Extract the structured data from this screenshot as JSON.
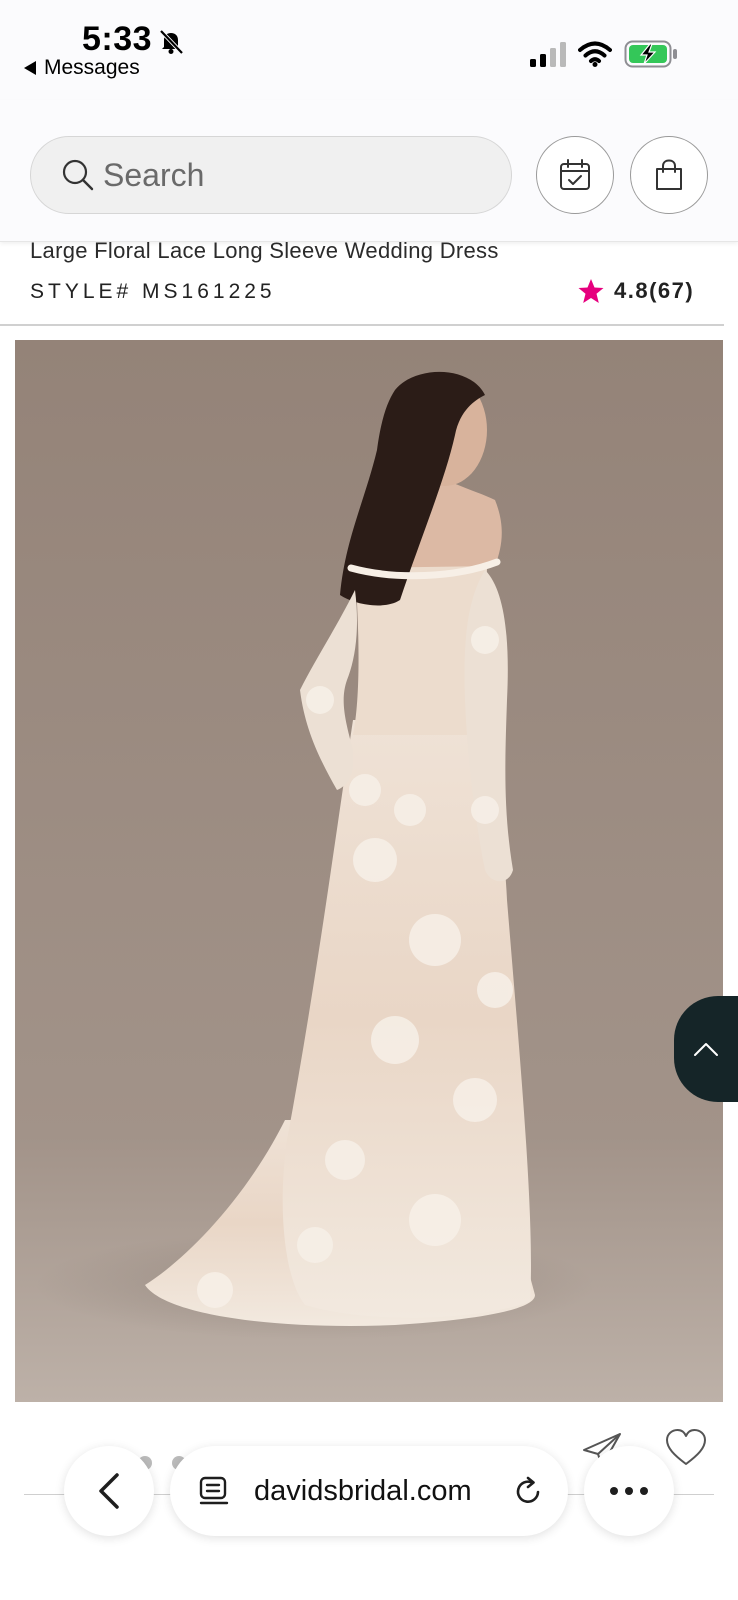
{
  "status_bar": {
    "time": "5:33",
    "back_label": "Messages",
    "icons": [
      "bell-slash-icon",
      "cellular-signal-icon",
      "wifi-icon",
      "battery-charging-icon"
    ],
    "battery_color": "#34c759"
  },
  "header": {
    "search_placeholder": "Search",
    "icons": [
      "search-icon",
      "calendar-check-icon",
      "shopping-bag-icon"
    ]
  },
  "product": {
    "title": "Large Floral Lace Long Sleeve Wedding Dress",
    "style": "STYLE# MS161225",
    "rating": "4.8(67)",
    "rating_star_color": "#e6007e"
  },
  "colors": {
    "image_background": "#9e8f86",
    "scroll_top_bg": "#152528"
  },
  "browser": {
    "url": "davidsbridal.com",
    "icons": [
      "chevron-left-icon",
      "reader-icon",
      "reload-icon",
      "more-icon"
    ]
  }
}
